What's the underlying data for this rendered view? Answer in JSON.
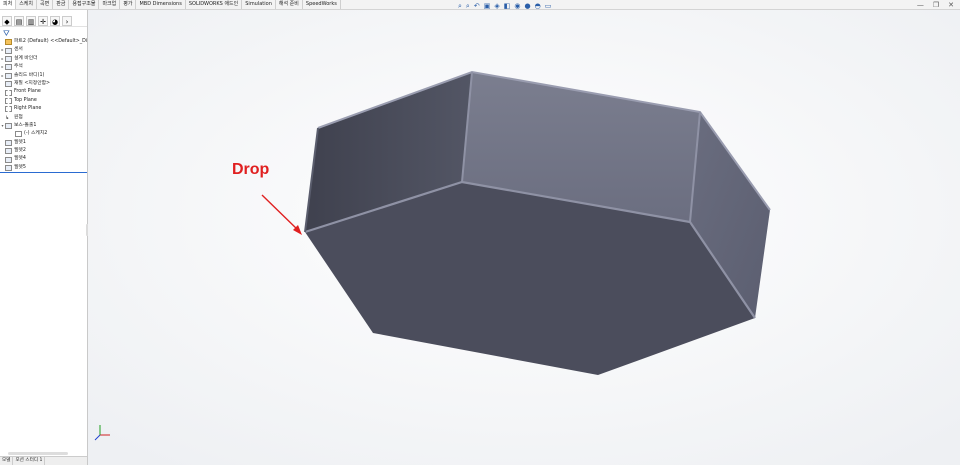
{
  "command_tabs": [
    "피처",
    "스케치",
    "곡면",
    "판금",
    "용접구조물",
    "마크업",
    "평가",
    "MBD Dimensions",
    "SOLIDWORKS 애드인",
    "Simulation",
    "해석 준비",
    "SpeedWorks"
  ],
  "hud_icons": [
    "zoom-icon",
    "zoom-area-icon",
    "previous-view-icon",
    "section-view-icon",
    "view-orientation-icon",
    "display-style-icon",
    "hide-show-icon",
    "appearance-icon",
    "scene-icon",
    "view-settings-icon"
  ],
  "window_controls": [
    "minimize-icon",
    "restore-icon",
    "close-icon"
  ],
  "feature_tree": {
    "root": "파트2 (Default) <<Default>_Display S",
    "items": [
      {
        "label": "센서",
        "type": "folder",
        "toggle": "▸"
      },
      {
        "label": "설계 바인더",
        "type": "folder",
        "toggle": "▸"
      },
      {
        "label": "주석",
        "type": "folder",
        "toggle": "▸"
      },
      {
        "label": "솔리드 바디(1)",
        "type": "folder",
        "toggle": "▸"
      },
      {
        "label": "재질 <지정안함>",
        "type": "material",
        "toggle": ""
      },
      {
        "label": "Front Plane",
        "type": "plane",
        "toggle": ""
      },
      {
        "label": "Top Plane",
        "type": "plane",
        "toggle": ""
      },
      {
        "label": "Right Plane",
        "type": "plane",
        "toggle": ""
      },
      {
        "label": "원점",
        "type": "origin",
        "toggle": ""
      },
      {
        "label": "보스-돌출1",
        "type": "feature",
        "toggle": "▾"
      },
      {
        "label": "(-) 스케치2",
        "type": "sketch",
        "toggle": ""
      },
      {
        "label": "필렛1",
        "type": "feature",
        "toggle": ""
      },
      {
        "label": "필렛2",
        "type": "feature",
        "toggle": ""
      },
      {
        "label": "필렛4",
        "type": "feature",
        "toggle": ""
      },
      {
        "label": "필렛5",
        "type": "feature",
        "toggle": ""
      }
    ]
  },
  "bottom_tabs": [
    "모델",
    "모션 스터디 1"
  ],
  "annotation": {
    "text": "Drop",
    "color": "#e02020"
  },
  "colors": {
    "model_dark": "#4a4c5a",
    "model_light": "#7a7d8e",
    "viewport_bg": "#ffffff"
  }
}
